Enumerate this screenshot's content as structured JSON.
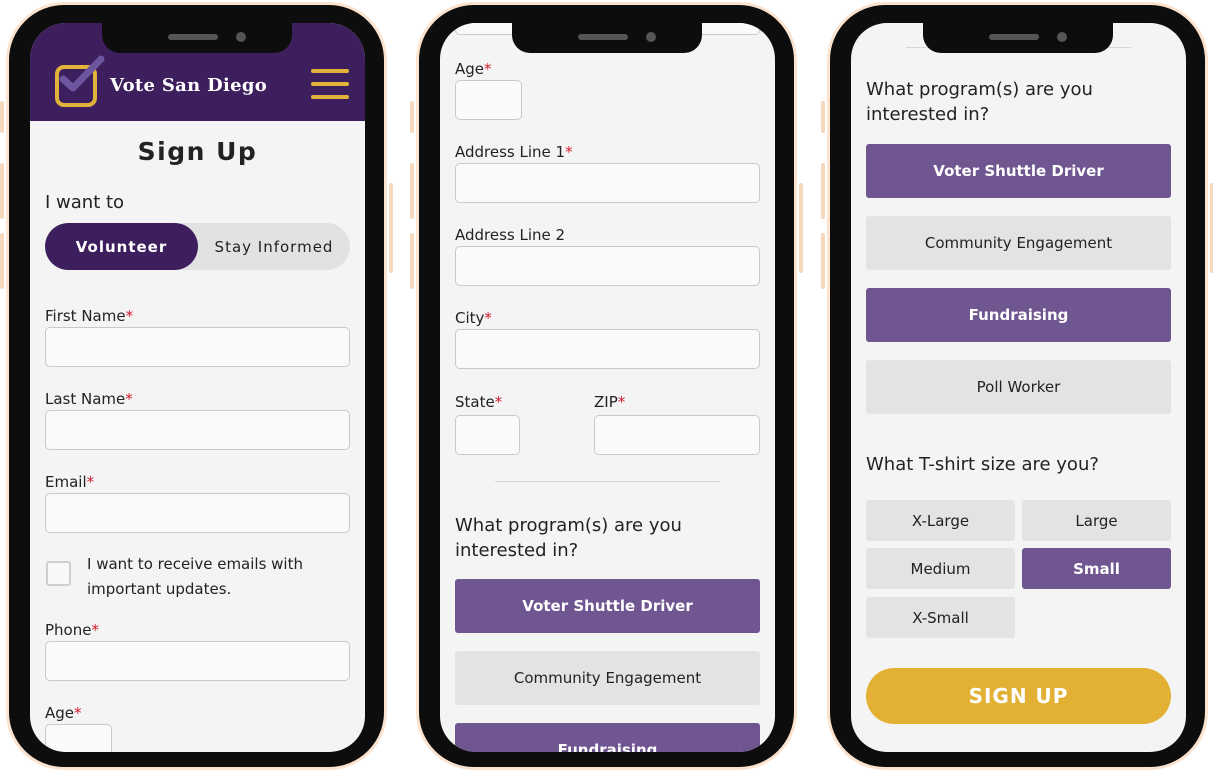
{
  "screen1": {
    "brand": "Vote San Diego",
    "title": "Sign Up",
    "want_label": "I want to",
    "toggle": {
      "selected": "Volunteer",
      "other": "Stay Informed"
    },
    "first_name": "First Name",
    "last_name": "Last Name",
    "email": "Email",
    "email_opt_in": [
      "I want to receive emails with",
      "important updates."
    ],
    "phone": "Phone",
    "age": "Age",
    "required_mark": "*"
  },
  "screen2": {
    "age": "Age",
    "address1": "Address Line 1",
    "address2": "Address Line 2",
    "city": "City",
    "state": "State",
    "zip": "ZIP",
    "required_mark": "*",
    "programs_question": [
      "What program(s) are you",
      "interested in?"
    ],
    "programs": [
      {
        "label": "Voter Shuttle Driver",
        "selected": true
      },
      {
        "label": "Community Engagement",
        "selected": false
      },
      {
        "label": "Fundraising",
        "selected": true
      }
    ]
  },
  "screen3": {
    "programs_question": [
      "What program(s) are you",
      "interested in?"
    ],
    "programs": [
      {
        "label": "Voter Shuttle Driver",
        "selected": true
      },
      {
        "label": "Community Engagement",
        "selected": false
      },
      {
        "label": "Fundraising",
        "selected": true
      },
      {
        "label": "Poll Worker",
        "selected": false
      }
    ],
    "tshirt_question": "What T-shirt size are you?",
    "sizes": [
      {
        "label": "X-Large",
        "selected": false
      },
      {
        "label": "Large",
        "selected": false
      },
      {
        "label": "Medium",
        "selected": false
      },
      {
        "label": "Small",
        "selected": true
      },
      {
        "label": "X-Small",
        "selected": false
      }
    ],
    "submit": "SIGN UP"
  },
  "colors": {
    "header_purple": "#3e1f5e",
    "selected_purple": "#705690",
    "accent_gold": "#e2b33a",
    "required_red": "#d11a2a"
  },
  "icons": [
    "checkbox-logo-icon",
    "hamburger-menu-icon"
  ]
}
